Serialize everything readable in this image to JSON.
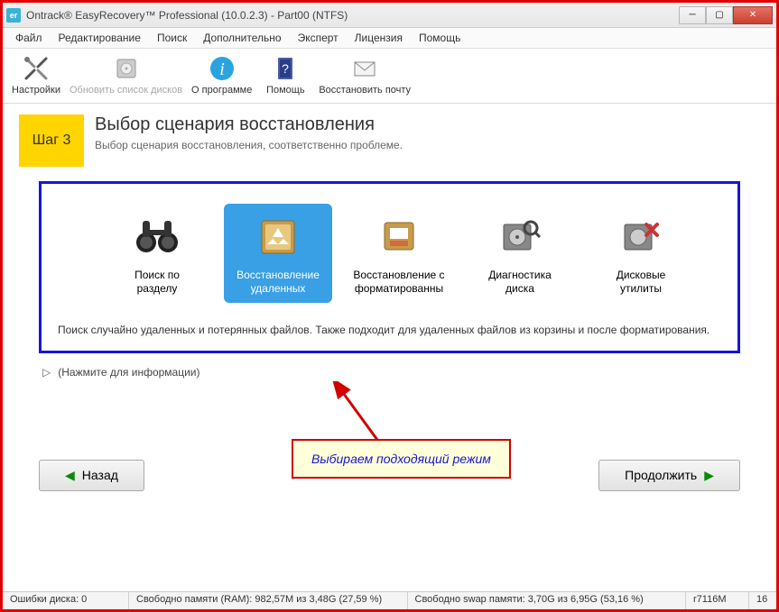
{
  "window": {
    "title": "Ontrack® EasyRecovery™ Professional (10.0.2.3) - Part00 (NTFS)",
    "app_icon_text": "er"
  },
  "menu": {
    "items": [
      "Файл",
      "Редактирование",
      "Поиск",
      "Дополнительно",
      "Эксперт",
      "Лицензия",
      "Помощь"
    ]
  },
  "toolbar": {
    "settings": "Настройки",
    "refresh": "Обновить список дисков",
    "about": "О программе",
    "help": "Помощь",
    "restore_mail": "Восстановить почту"
  },
  "step": {
    "badge": "Шаг 3",
    "title": "Выбор сценария восстановления",
    "subtitle": "Выбор сценария восстановления, соответственно проблеме."
  },
  "scenarios": {
    "items": [
      {
        "label": "Поиск по\nразделу"
      },
      {
        "label": "Восстановление\nудаленных"
      },
      {
        "label": "Восстановление с\nформатированны"
      },
      {
        "label": "Диагностика\nдиска"
      },
      {
        "label": "Дисковые\nутилиты"
      }
    ],
    "selected_index": 1,
    "description": "Поиск случайно удаленных и потерянных файлов. Также подходит для удаленных файлов из корзины и после форматирования."
  },
  "info_hint": "(Нажмите для информации)",
  "callout": "Выбираем подходящий режим",
  "nav": {
    "back": "Назад",
    "next": "Продолжить"
  },
  "status": {
    "errors": "Ошибки диска: 0",
    "ram": "Свободно памяти (RAM): 982,57M из 3,48G (27,59 %)",
    "swap": "Свободно swap памяти: 3,70G из 6,95G (53,16 %)",
    "r": "r7116M",
    "n": "16"
  }
}
